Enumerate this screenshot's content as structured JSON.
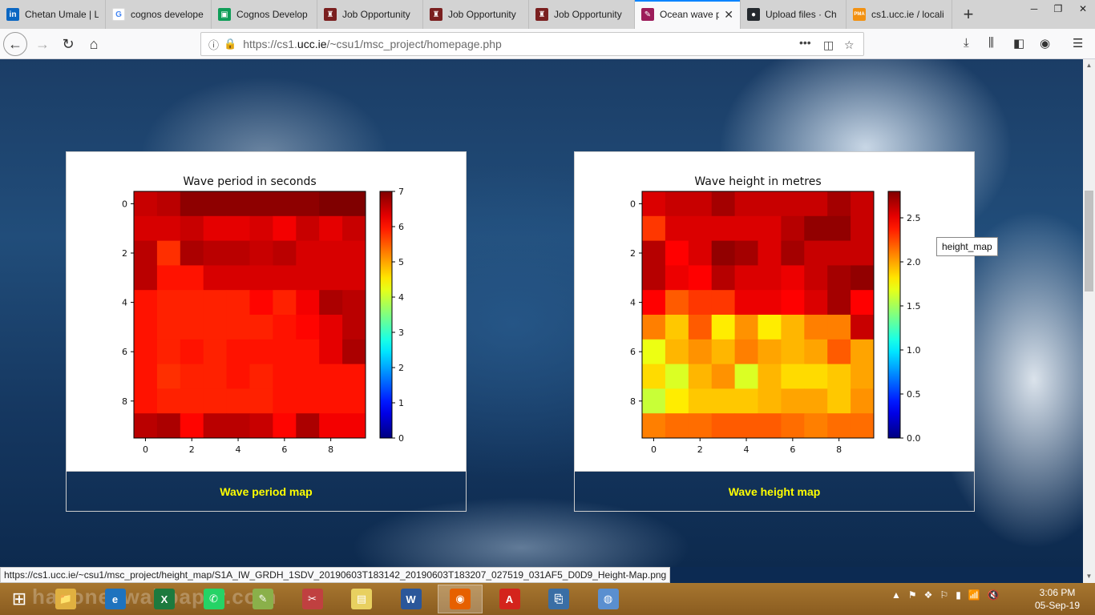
{
  "tabs": [
    {
      "label": "Chetan Umale | L",
      "icon": "linkedin-icon",
      "color": "#0a66c2",
      "glyph": "in"
    },
    {
      "label": "cognos develope",
      "icon": "google-icon",
      "color": "#ffffff",
      "glyph": "G"
    },
    {
      "label": "Cognos Develop",
      "icon": "classroom-icon",
      "color": "#0f9d58",
      "glyph": "▣"
    },
    {
      "label": "Job Opportunity",
      "icon": "ucc-crest-icon",
      "color": "#7a1f1f",
      "glyph": "♜"
    },
    {
      "label": "Job Opportunity",
      "icon": "ucc-crest-icon",
      "color": "#7a1f1f",
      "glyph": "♜"
    },
    {
      "label": "Job Opportunity",
      "icon": "ucc-crest-icon",
      "color": "#7a1f1f",
      "glyph": "♜"
    },
    {
      "label": "Ocean wave p",
      "icon": "feather-icon",
      "color": "#9c1c5a",
      "glyph": "✎",
      "active": true
    },
    {
      "label": "Upload files · Ch",
      "icon": "github-icon",
      "color": "#24292e",
      "glyph": "●"
    },
    {
      "label": "cs1.ucc.ie / locali",
      "icon": "phpmyadmin-icon",
      "color": "#f29111",
      "glyph": "PMA"
    }
  ],
  "url": {
    "prefix": "https://cs1.",
    "host": "ucc.ie",
    "suffix": "/~csu1/msc_project/homepage.php"
  },
  "panels": [
    {
      "caption": "Wave period map",
      "figure": {
        "title": "Wave period in seconds",
        "colorbar_ticks": [
          "0",
          "1",
          "2",
          "3",
          "4",
          "5",
          "6",
          "7"
        ],
        "x_ticks": [
          "0",
          "2",
          "4",
          "6",
          "8"
        ],
        "y_ticks": [
          "0",
          "2",
          "4",
          "6",
          "8"
        ]
      }
    },
    {
      "caption": "Wave height map",
      "figure": {
        "title": "Wave height in metres",
        "colorbar_ticks": [
          "0.0",
          "0.5",
          "1.0",
          "1.5",
          "2.0",
          "2.5"
        ],
        "x_ticks": [
          "0",
          "2",
          "4",
          "6",
          "8"
        ],
        "y_ticks": [
          "0",
          "2",
          "4",
          "6",
          "8"
        ]
      }
    }
  ],
  "chart_data": [
    {
      "type": "heatmap",
      "title": "Wave period in seconds",
      "xlabel": "",
      "ylabel": "",
      "colormap": "jet",
      "vmin": 0,
      "vmax": 7,
      "x": [
        0,
        1,
        2,
        3,
        4,
        5,
        6,
        7,
        8,
        9
      ],
      "y": [
        0,
        1,
        2,
        3,
        4,
        5,
        6,
        7,
        8,
        9
      ],
      "values": [
        [
          6.5,
          6.6,
          6.9,
          6.9,
          6.9,
          6.9,
          6.9,
          6.9,
          7.0,
          7.0
        ],
        [
          6.4,
          6.4,
          6.5,
          6.3,
          6.3,
          6.4,
          6.2,
          6.5,
          6.3,
          6.5
        ],
        [
          6.6,
          5.8,
          6.7,
          6.6,
          6.6,
          6.5,
          6.6,
          6.4,
          6.4,
          6.4
        ],
        [
          6.6,
          6.0,
          6.0,
          6.4,
          6.4,
          6.4,
          6.4,
          6.4,
          6.4,
          6.4
        ],
        [
          6.0,
          5.9,
          5.9,
          5.9,
          5.9,
          6.1,
          5.9,
          6.2,
          6.7,
          6.6
        ],
        [
          6.0,
          5.9,
          5.9,
          5.9,
          5.9,
          5.9,
          6.0,
          6.1,
          6.3,
          6.6
        ],
        [
          6.0,
          5.9,
          6.0,
          5.9,
          6.0,
          6.0,
          6.0,
          6.0,
          6.3,
          6.7
        ],
        [
          6.0,
          5.8,
          5.9,
          5.9,
          6.0,
          5.9,
          6.0,
          6.0,
          6.0,
          6.0
        ],
        [
          6.0,
          5.9,
          5.9,
          5.9,
          5.9,
          5.9,
          6.0,
          6.0,
          6.0,
          6.0
        ],
        [
          6.6,
          6.7,
          6.1,
          6.6,
          6.6,
          6.5,
          6.1,
          6.7,
          6.2,
          6.2
        ]
      ]
    },
    {
      "type": "heatmap",
      "title": "Wave height in metres",
      "xlabel": "",
      "ylabel": "",
      "colormap": "jet",
      "vmin": 0.0,
      "vmax": 2.8,
      "x": [
        0,
        1,
        2,
        3,
        4,
        5,
        6,
        7,
        8,
        9
      ],
      "y": [
        0,
        1,
        2,
        3,
        4,
        5,
        6,
        7,
        8,
        9
      ],
      "values": [
        [
          2.55,
          2.6,
          2.6,
          2.7,
          2.6,
          2.6,
          2.6,
          2.6,
          2.7,
          2.6
        ],
        [
          2.3,
          2.55,
          2.55,
          2.55,
          2.55,
          2.55,
          2.65,
          2.75,
          2.75,
          2.6
        ],
        [
          2.65,
          2.45,
          2.55,
          2.75,
          2.7,
          2.55,
          2.7,
          2.6,
          2.6,
          2.6
        ],
        [
          2.65,
          2.5,
          2.45,
          2.65,
          2.55,
          2.55,
          2.5,
          2.6,
          2.7,
          2.75
        ],
        [
          2.45,
          2.2,
          2.3,
          2.3,
          2.5,
          2.5,
          2.45,
          2.55,
          2.7,
          2.45
        ],
        [
          2.1,
          1.9,
          2.2,
          1.8,
          2.05,
          1.8,
          1.95,
          2.1,
          2.1,
          2.6
        ],
        [
          1.7,
          1.95,
          2.05,
          1.95,
          2.1,
          2.0,
          1.95,
          2.0,
          2.2,
          2.0
        ],
        [
          1.85,
          1.65,
          1.95,
          2.05,
          1.65,
          1.95,
          1.85,
          1.85,
          1.9,
          2.0
        ],
        [
          1.6,
          1.8,
          1.9,
          1.9,
          1.9,
          1.95,
          2.0,
          2.0,
          1.9,
          2.05
        ],
        [
          2.1,
          2.15,
          2.15,
          2.2,
          2.2,
          2.2,
          2.15,
          2.1,
          2.15,
          2.15
        ]
      ]
    }
  ],
  "tooltip": "height_map",
  "status_link": "https://cs1.ucc.ie/~csu1/msc_project/height_map/S1A_IW_GRDH_1SDV_20190603T183142_20190603T183207_027519_031AF5_D0D9_Height-Map.png",
  "taskbar": {
    "watermark": "halloneswallpaper.com",
    "apps": [
      {
        "name": "file-explorer-icon",
        "glyph": "📁",
        "color": "#e0b040"
      },
      {
        "name": "edge-icon",
        "glyph": "e",
        "color": "#1e73be"
      },
      {
        "name": "excel-icon",
        "glyph": "X",
        "color": "#1d7a3e"
      },
      {
        "name": "whatsapp-icon",
        "glyph": "✆",
        "color": "#25d366"
      },
      {
        "name": "notepad-plus-icon",
        "glyph": "✎",
        "color": "#8ab04a"
      },
      {
        "name": "paint-brush-icon",
        "glyph": "✂",
        "color": "#c04040"
      },
      {
        "name": "sticky-notes-icon",
        "glyph": "▤",
        "color": "#e8d060"
      },
      {
        "name": "word-icon",
        "glyph": "W",
        "color": "#2b579a"
      },
      {
        "name": "firefox-icon",
        "glyph": "◉",
        "color": "#e66000",
        "active": true
      },
      {
        "name": "acrobat-icon",
        "glyph": "A",
        "color": "#d4241c"
      },
      {
        "name": "copy-files-icon",
        "glyph": "⎘",
        "color": "#3a6ea5"
      },
      {
        "name": "paint-palette-icon",
        "glyph": "◍",
        "color": "#5a8fd0"
      }
    ],
    "time": "3:06 PM",
    "date": "05-Sep-19"
  }
}
